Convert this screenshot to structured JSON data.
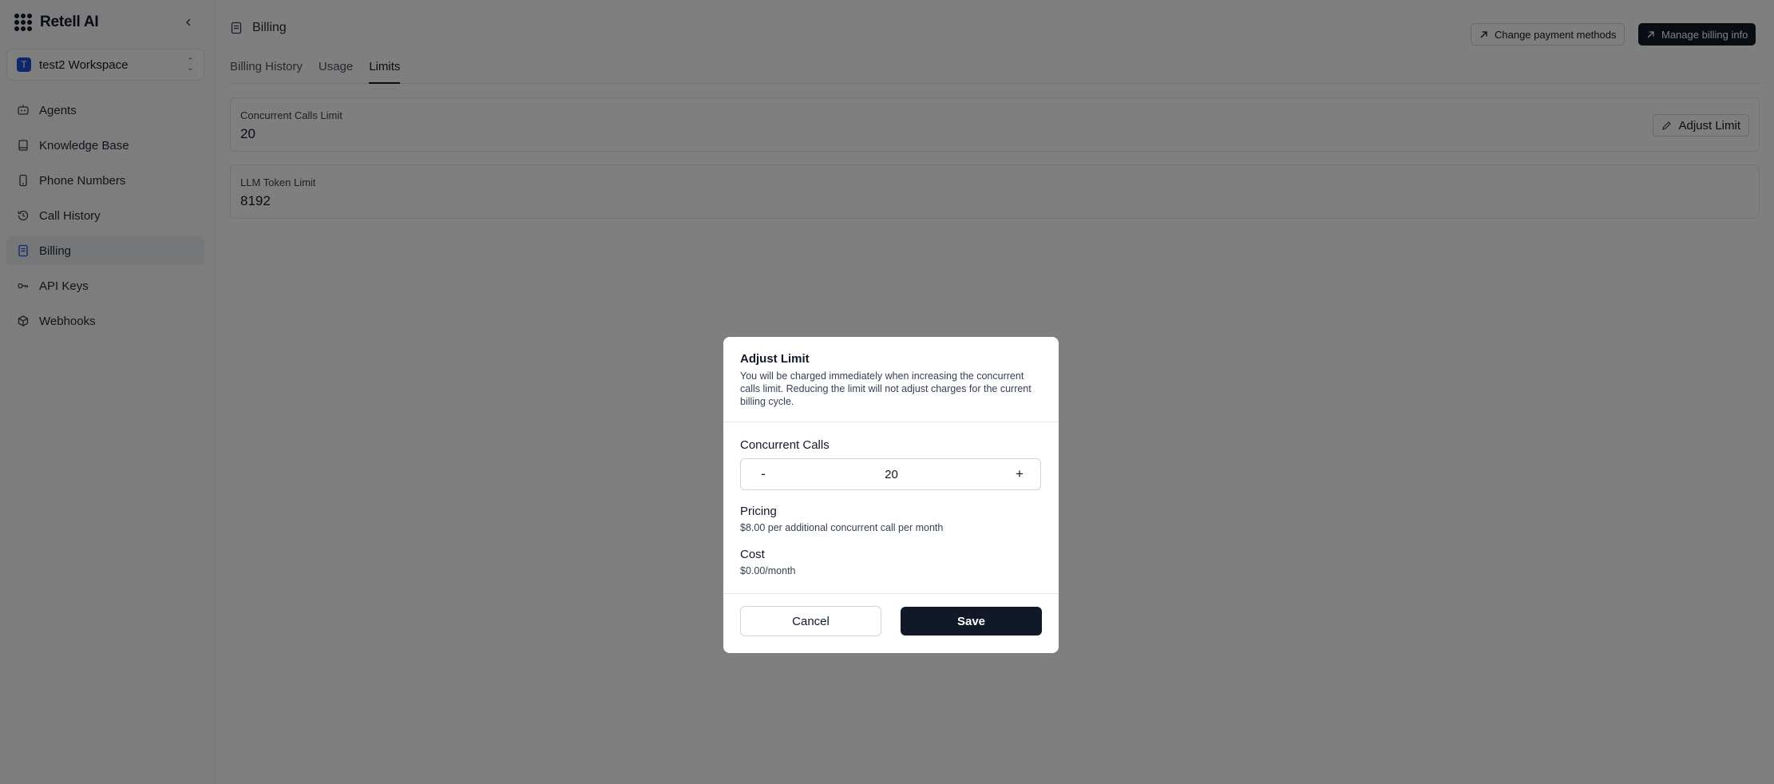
{
  "app": {
    "brand_name": "Retell AI",
    "workspace": {
      "initial": "T",
      "name": "test2 Workspace"
    }
  },
  "sidebar": {
    "items": [
      {
        "label": "Agents",
        "icon": "robot-icon",
        "active": false
      },
      {
        "label": "Knowledge Base",
        "icon": "book-icon",
        "active": false
      },
      {
        "label": "Phone Numbers",
        "icon": "phone-icon",
        "active": false
      },
      {
        "label": "Call History",
        "icon": "history-icon",
        "active": false
      },
      {
        "label": "Billing",
        "icon": "receipt-icon",
        "active": true
      },
      {
        "label": "API Keys",
        "icon": "key-icon",
        "active": false
      },
      {
        "label": "Webhooks",
        "icon": "webhook-icon",
        "active": false
      }
    ]
  },
  "header": {
    "title": "Billing",
    "change_payment_label": "Change payment methods",
    "manage_billing_label": "Manage billing info"
  },
  "tabs": [
    {
      "label": "Billing History",
      "active": false
    },
    {
      "label": "Usage",
      "active": false
    },
    {
      "label": "Limits",
      "active": true
    }
  ],
  "limits": {
    "concurrent": {
      "label": "Concurrent Calls Limit",
      "value": "20",
      "button": "Adjust Limit"
    },
    "llm_token": {
      "label": "LLM Token Limit",
      "value": "8192"
    }
  },
  "modal": {
    "title": "Adjust Limit",
    "description": "You will be charged immediately when increasing the concurrent calls limit. Reducing the limit will not adjust charges for the current billing cycle.",
    "concurrent_label": "Concurrent Calls",
    "decrement": "-",
    "increment": "+",
    "concurrent_value": "20",
    "pricing_label": "Pricing",
    "pricing_text": "$8.00 per additional concurrent call per month",
    "cost_label": "Cost",
    "cost_text": "$0.00/month",
    "cancel_label": "Cancel",
    "save_label": "Save"
  },
  "colors": {
    "accent_dark": "#111827",
    "workspace_avatar": "#1d4ed8",
    "overlay": "rgba(0,0,0,0.5)"
  }
}
